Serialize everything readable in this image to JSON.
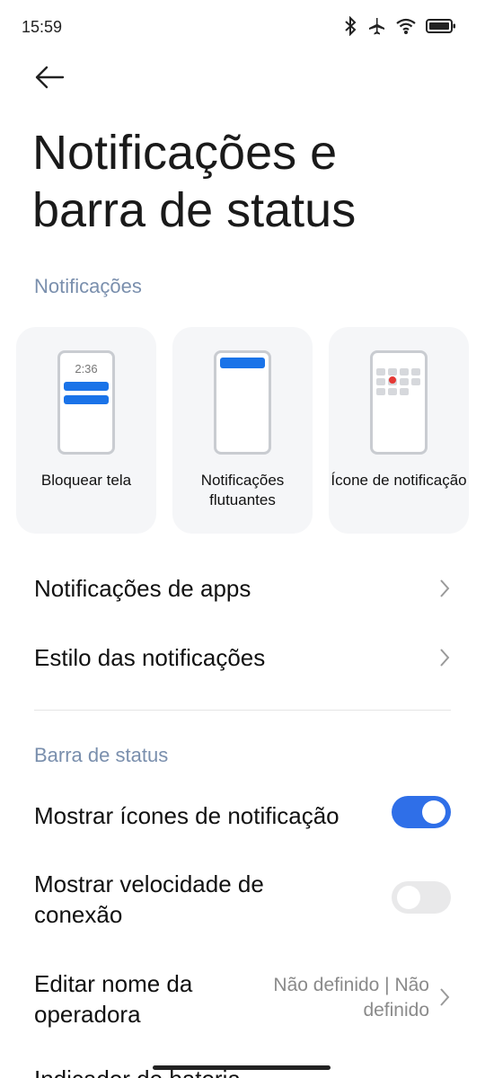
{
  "status_bar": {
    "time": "15:59",
    "icons": [
      "bluetooth-icon",
      "airplane-icon",
      "wifi-icon",
      "battery-icon"
    ]
  },
  "page_title": "Notificações e barra de status",
  "notifications_section": {
    "label": "Notificações",
    "cards": [
      {
        "label": "Bloquear tela",
        "preview_time": "2:36"
      },
      {
        "label": "Notificações flutuantes"
      },
      {
        "label": "Ícone de notificação"
      }
    ],
    "rows": [
      {
        "title": "Notificações de apps"
      },
      {
        "title": "Estilo das notificações"
      }
    ]
  },
  "status_section": {
    "label": "Barra de status",
    "show_notification_icons": {
      "title": "Mostrar ícones de notificação",
      "enabled": true
    },
    "show_connection_speed": {
      "title": "Mostrar velocidade de conexão",
      "enabled": false
    },
    "edit_carrier_name": {
      "title": "Editar nome da operadora",
      "value": "Não definido | Não definido"
    },
    "battery_indicator_partial": "Indicador de bateria"
  },
  "colors": {
    "accent": "#2f6fe8",
    "section_label": "#7a8fad",
    "card_bg": "#f5f6f8"
  }
}
